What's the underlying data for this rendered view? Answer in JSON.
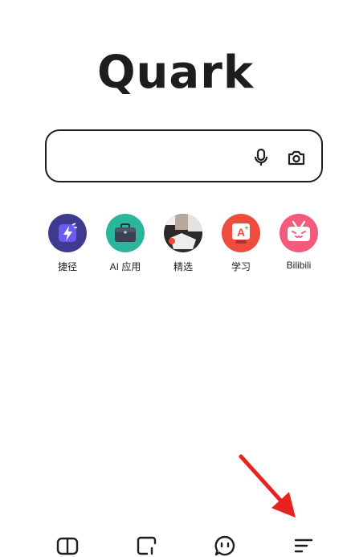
{
  "logo": {
    "text": "Quark"
  },
  "search": {
    "value": "",
    "placeholder": "",
    "mic_icon": "microphone-icon",
    "camera_icon": "camera-icon"
  },
  "shortcuts": [
    {
      "label": "捷径",
      "icon": "lightning-icon",
      "color": "#3f3a8f"
    },
    {
      "label": "AI 应用",
      "icon": "briefcase-icon",
      "color": "#2bb59a"
    },
    {
      "label": "精选",
      "icon": "featured-icon",
      "color": "#2a2a2a"
    },
    {
      "label": "学习",
      "icon": "study-icon",
      "color": "#ef4b3f"
    },
    {
      "label": "Bilibili",
      "icon": "bilibili-icon",
      "color": "#f45a7a"
    }
  ],
  "bottom_nav": [
    {
      "icon": "book-icon"
    },
    {
      "icon": "tabs-icon"
    },
    {
      "icon": "chat-face-icon"
    },
    {
      "icon": "menu-icon"
    }
  ],
  "annotation": {
    "icon": "red-arrow-icon",
    "color": "#e8231f"
  }
}
